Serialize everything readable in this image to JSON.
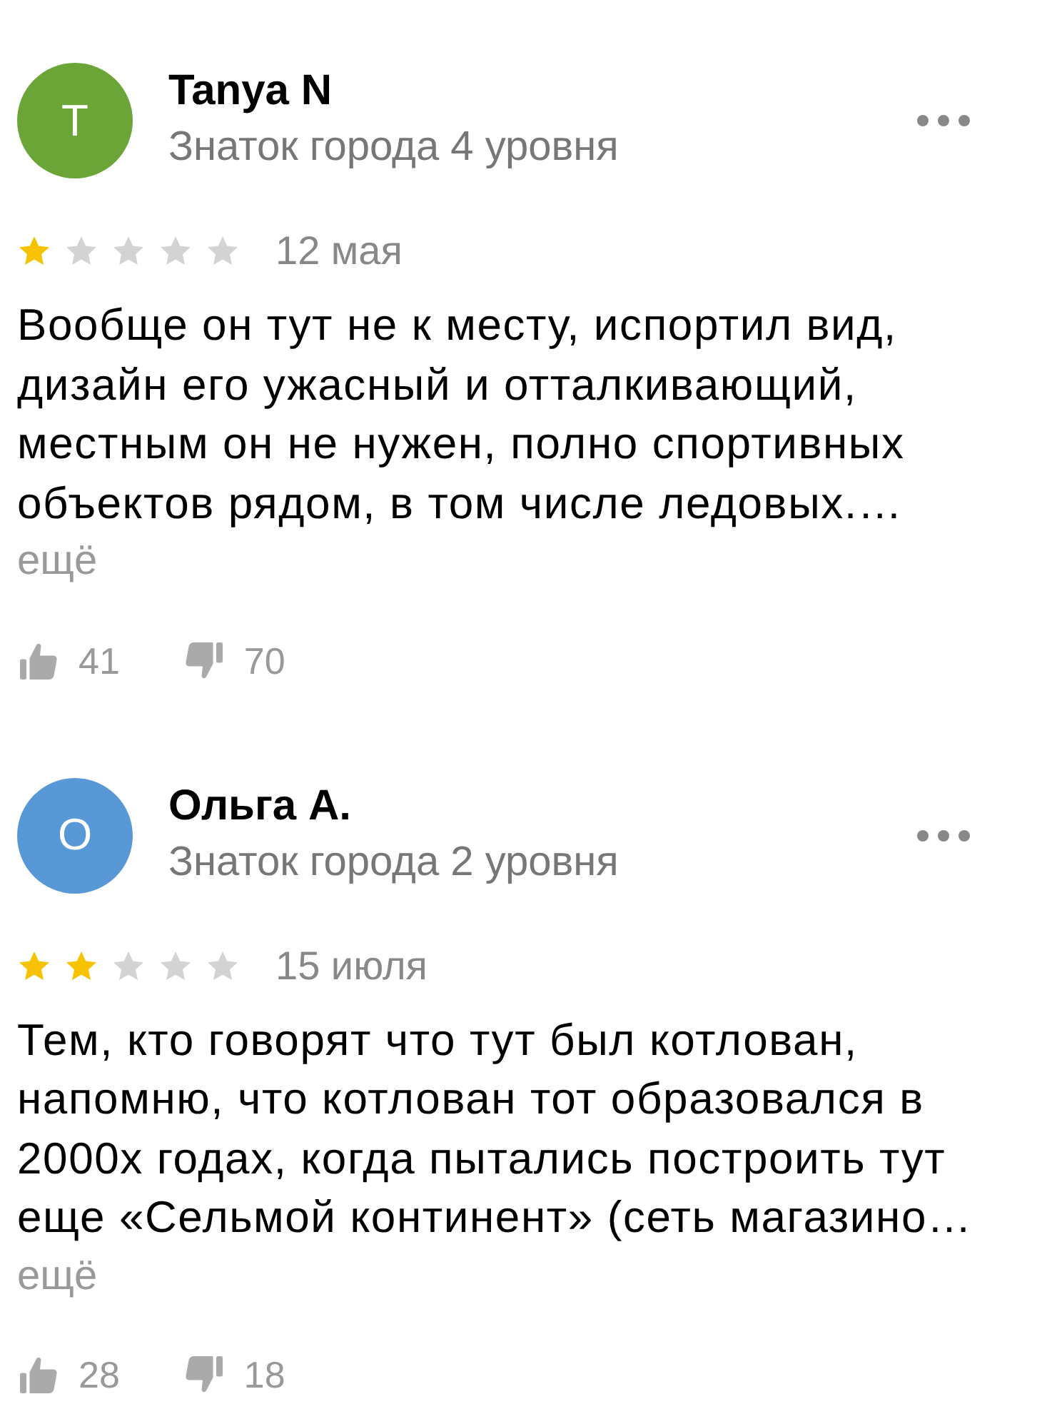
{
  "reviews": [
    {
      "author": "Tanya N",
      "avatar_letter": "T",
      "color": "#6ba538",
      "author_status": "Знаток города 4 уровня",
      "stars": 1,
      "date": "12 мая",
      "text": "Вообще он тут не к месту, испортил вид,\nдизайн его ужасный и отталкивающий,\nместным он не нужен, полно спортивных\nобъектов рядом, в том числе ледовых.…",
      "more": "ещё",
      "likes": "41",
      "dislikes": "70"
    },
    {
      "author": "Ольга А.",
      "avatar_letter": "О",
      "color": "#5898d6",
      "author_status": "Знаток города 2 уровня",
      "stars": 2,
      "date": "15 июля",
      "text": "Тем, кто говорят что тут был котлован,\nнапомню, что котлован тот образовался в\n2000х годах, когда пытались построить тут\nеще «Сельмой континент» (сеть магазино…",
      "more": "ещё",
      "likes": "28",
      "dislikes": "18"
    }
  ]
}
